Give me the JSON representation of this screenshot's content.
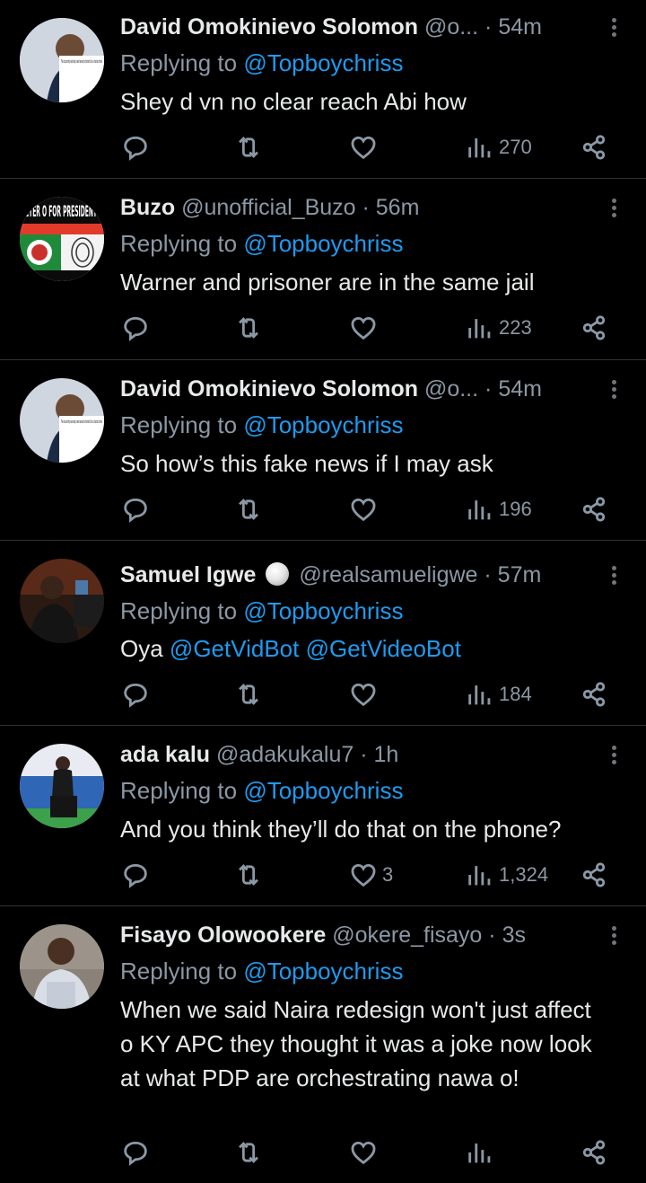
{
  "tweets": [
    {
      "name": "David Omokinievo Solomon",
      "handle": "@o...",
      "time": "54m",
      "replying_label": "Replying to",
      "replying_to": "@Topboychriss",
      "text": "Shey d vn no clear reach Abi how",
      "likes": "",
      "views": "270",
      "avatar_caption": "The structure they have today is what we want to dismantle. It is a structure criminal"
    },
    {
      "name": "Buzo",
      "handle": "@unofficial_Buzo",
      "time": "56m",
      "replying_label": "Replying to",
      "replying_to": "@Topboychriss",
      "text": "Warner and prisoner are in the same jail",
      "likes": "",
      "views": "223",
      "avatar_caption": "ETER O FOR PRESIDENT"
    },
    {
      "name": "David Omokinievo Solomon",
      "handle": "@o...",
      "time": "54m",
      "replying_label": "Replying to",
      "replying_to": "@Topboychriss",
      "text": "So how’s this fake news if I may ask",
      "likes": "",
      "views": "196",
      "avatar_caption": "The structure they have today is what we want to dismantle. It is a structure criminal"
    },
    {
      "name": "Samuel Igwe",
      "handle": "@realsamueligwe",
      "time": "57m",
      "replying_label": "Replying to",
      "replying_to": "@Topboychriss",
      "text_prefix": "Oya ",
      "mention1": "@GetVidBot",
      "mention2": "@GetVideoBot",
      "likes": "",
      "views": "184"
    },
    {
      "name": "ada kalu",
      "handle": "@adakukalu7",
      "time": "1h",
      "replying_label": "Replying to",
      "replying_to": "@Topboychriss",
      "text": "And you think they’ll do that on the phone?",
      "likes": "3",
      "views": "1,324"
    },
    {
      "name": "Fisayo Olowookere",
      "handle": "@okere_fisayo",
      "time": "3s",
      "replying_label": "Replying to",
      "replying_to": "@Topboychriss",
      "text": "When we said Naira redesign won't just affect o KY APC they thought it was a joke now look at what PDP are orchestrating nawa o!",
      "likes": "",
      "views": ""
    }
  ],
  "separator": "·",
  "colors": {
    "background": "#000000",
    "text": "#e7e9ea",
    "muted": "#8b98a5",
    "accent": "#1d9bf0",
    "divider": "#2f3336"
  },
  "icons": [
    "reply-icon",
    "retweet-icon",
    "like-icon",
    "views-icon",
    "share-icon",
    "more-icon"
  ]
}
